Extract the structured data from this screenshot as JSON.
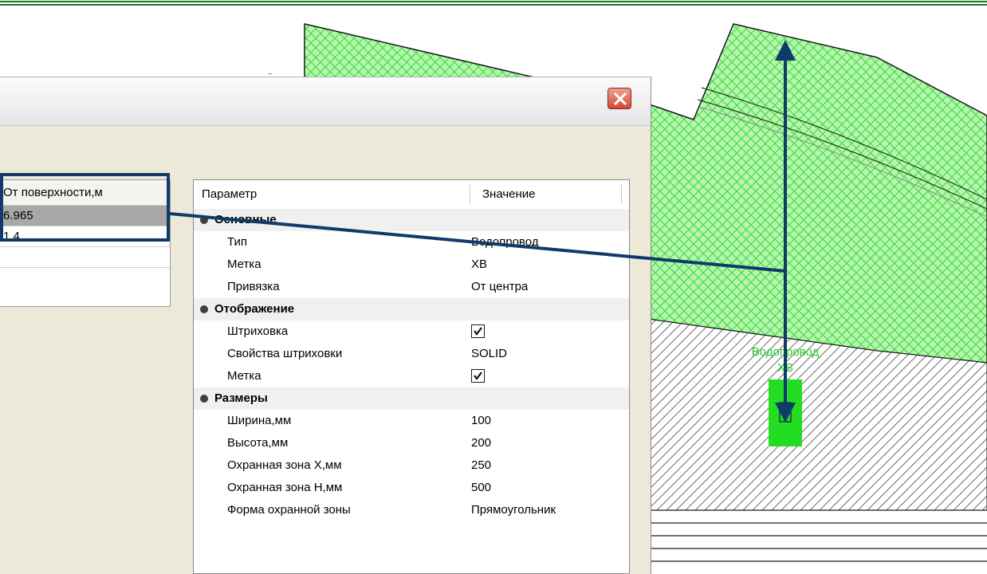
{
  "canvas": {
    "label_line1": "Водопровод",
    "label_line2": "ХВ"
  },
  "colors": {
    "accent": "#103a6a",
    "hatch_green": "#33dd33",
    "pipe_green": "#22dd22"
  },
  "dialog": {
    "close_icon": "close-icon"
  },
  "depth_grid": {
    "header": "От поверхности,м",
    "rows": [
      "6.965",
      "1.4",
      ""
    ]
  },
  "properties": {
    "header_param": "Параметр",
    "header_value": "Значение",
    "categories": {
      "main": "Основные",
      "display": "Отображение",
      "sizes": "Размеры"
    },
    "rows": {
      "type": {
        "name": "Тип",
        "value": "Водопровод"
      },
      "mark": {
        "name": "Метка",
        "value": "ХВ"
      },
      "anchor": {
        "name": "Привязка",
        "value": "От центра"
      },
      "hatch": {
        "name": "Штриховка",
        "checked": true
      },
      "hatch_props": {
        "name": "Свойства штриховки",
        "value": "SOLID"
      },
      "mark_show": {
        "name": "Метка",
        "checked": true
      },
      "width": {
        "name": "Ширина,мм",
        "value": "100"
      },
      "height": {
        "name": "Высота,мм",
        "value": "200"
      },
      "zone_x": {
        "name": "Охранная зона X,мм",
        "value": "250"
      },
      "zone_h": {
        "name": "Охранная зона H,мм",
        "value": "500"
      },
      "zone_shape": {
        "name": "Форма охранной зоны",
        "value": "Прямоугольник"
      }
    }
  }
}
